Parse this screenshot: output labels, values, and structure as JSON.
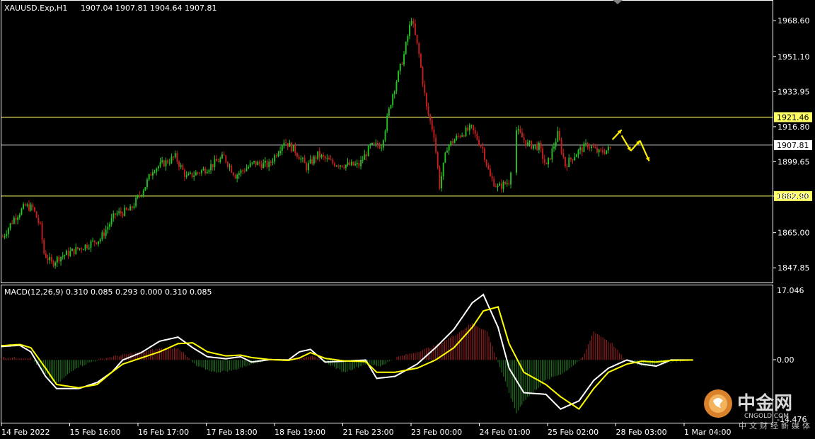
{
  "header": {
    "symbol": "XAUUSD.Exp,H1",
    "ohlc": "1907.04 1907.81 1904.64 1907.81"
  },
  "macd": {
    "label": "MACD(12,26,9) 0.310 0.085 0.293 0.000 0.310 0.085",
    "ticks": [
      "17.046",
      "0.00",
      "-14.476"
    ]
  },
  "watermark": {
    "cn": "中金网",
    "en": "CNGOLD.COM",
    "sub": "中文财经新媒体"
  },
  "colors": {
    "bull": "#22c322",
    "bear": "#c81e1e",
    "level": "#ffff66",
    "current": "#bfbfbf",
    "macd_line": "#ffffff",
    "signal_line": "#ffff00",
    "arrow": "#ffee00"
  },
  "chart_data": [
    {
      "type": "candlestick",
      "title": "XAUUSD.Exp,H1",
      "y_ticks": [
        "1968.60",
        "1951.10",
        "1933.95",
        "1916.80",
        "1899.65",
        "1882.90",
        "1865.00",
        "1847.85"
      ],
      "ylim": [
        1841,
        1978
      ],
      "x_labels": [
        "14 Feb 2022",
        "15 Feb 16:00",
        "16 Feb 17:00",
        "17 Feb 18:00",
        "18 Feb 19:00",
        "21 Feb 23:00",
        "23 Feb 00:00",
        "24 Feb 01:00",
        "25 Feb 02:00",
        "28 Feb 03:00",
        "1 Mar 04:00"
      ],
      "levels": [
        {
          "label": "1921.46",
          "value": 1921.46
        },
        {
          "label": "1907.81",
          "value": 1907.81
        },
        {
          "label": "1882.90",
          "value": 1882.9
        }
      ],
      "close_anchors": [
        [
          0,
          1863
        ],
        [
          6,
          1872
        ],
        [
          12,
          1878
        ],
        [
          16,
          1877
        ],
        [
          20,
          1868
        ],
        [
          22,
          1855
        ],
        [
          26,
          1850
        ],
        [
          30,
          1853
        ],
        [
          40,
          1857
        ],
        [
          52,
          1862
        ],
        [
          60,
          1874
        ],
        [
          68,
          1876
        ],
        [
          76,
          1888
        ],
        [
          80,
          1896
        ],
        [
          92,
          1902
        ],
        [
          98,
          1892
        ],
        [
          108,
          1896
        ],
        [
          118,
          1902
        ],
        [
          124,
          1893
        ],
        [
          134,
          1899
        ],
        [
          142,
          1898
        ],
        [
          150,
          1910
        ],
        [
          156,
          1905
        ],
        [
          162,
          1897
        ],
        [
          168,
          1903
        ],
        [
          176,
          1899
        ],
        [
          184,
          1898
        ],
        [
          190,
          1898
        ],
        [
          196,
          1907
        ],
        [
          202,
          1908
        ],
        [
          208,
          1933
        ],
        [
          214,
          1952
        ],
        [
          218,
          1970
        ],
        [
          222,
          1952
        ],
        [
          226,
          1926
        ],
        [
          230,
          1913
        ],
        [
          233,
          1888
        ],
        [
          237,
          1907
        ],
        [
          244,
          1913
        ],
        [
          250,
          1916
        ],
        [
          256,
          1906
        ],
        [
          260,
          1892
        ],
        [
          264,
          1887
        ],
        [
          270,
          1890
        ],
        [
          274,
          1915
        ],
        [
          280,
          1908
        ],
        [
          286,
          1907
        ],
        [
          290,
          1897
        ],
        [
          296,
          1913
        ],
        [
          300,
          1898
        ],
        [
          306,
          1904
        ],
        [
          312,
          1908
        ],
        [
          318,
          1904
        ],
        [
          324,
          1906
        ]
      ],
      "gap": [
        271,
        274
      ],
      "forecast_zigzag": [
        [
          1910.5
        ],
        [
          1912.5
        ],
        [
          1905
        ],
        [
          1910
        ],
        [
          1900
        ]
      ]
    },
    {
      "type": "line",
      "title": "MACD(12,26,9)",
      "ylim": [
        -14.476,
        17.046
      ],
      "series": [
        {
          "name": "MACD",
          "points": [
            [
              0,
              3.3
            ],
            [
              10,
              3.6
            ],
            [
              16,
              2.0
            ],
            [
              24,
              -4.0
            ],
            [
              30,
              -7.0
            ],
            [
              42,
              -7.0
            ],
            [
              52,
              -5.5
            ],
            [
              60,
              -3.0
            ],
            [
              66,
              0.0
            ],
            [
              76,
              1.8
            ],
            [
              86,
              4.6
            ],
            [
              96,
              5.6
            ],
            [
              104,
              3.0
            ],
            [
              112,
              0.8
            ],
            [
              122,
              0.3
            ],
            [
              130,
              0.8
            ],
            [
              136,
              -0.5
            ],
            [
              146,
              0.1
            ],
            [
              156,
              0.0
            ],
            [
              162,
              2.0
            ],
            [
              168,
              2.6
            ],
            [
              176,
              -0.5
            ],
            [
              186,
              -0.3
            ],
            [
              198,
              0.0
            ],
            [
              204,
              -4.5
            ],
            [
              214,
              -4.0
            ],
            [
              226,
              -1.0
            ],
            [
              236,
              3.0
            ],
            [
              246,
              7.5
            ],
            [
              256,
              14.0
            ],
            [
              262,
              16.0
            ],
            [
              270,
              8.0
            ],
            [
              276,
              -2.0
            ],
            [
              284,
              -8.0
            ],
            [
              296,
              -8.4
            ],
            [
              304,
              -12.0
            ],
            [
              314,
              -10.0
            ],
            [
              322,
              -5.0
            ],
            [
              330,
              -2.0
            ],
            [
              340,
              0.0
            ],
            [
              348,
              -1.0
            ],
            [
              356,
              -1.5
            ],
            [
              364,
              0.0
            ],
            [
              376,
              0.0
            ]
          ]
        },
        {
          "name": "Signal",
          "points": [
            [
              0,
              3.5
            ],
            [
              10,
              3.8
            ],
            [
              16,
              3.0
            ],
            [
              24,
              -2.0
            ],
            [
              30,
              -6.0
            ],
            [
              42,
              -6.8
            ],
            [
              52,
              -6.0
            ],
            [
              60,
              -3.0
            ],
            [
              66,
              -1.0
            ],
            [
              76,
              0.5
            ],
            [
              86,
              2.0
            ],
            [
              96,
              4.0
            ],
            [
              104,
              4.2
            ],
            [
              112,
              2.0
            ],
            [
              122,
              1.0
            ],
            [
              130,
              1.2
            ],
            [
              136,
              0.6
            ],
            [
              146,
              0.1
            ],
            [
              156,
              -0.1
            ],
            [
              162,
              0.5
            ],
            [
              168,
              1.8
            ],
            [
              176,
              0.4
            ],
            [
              186,
              -0.2
            ],
            [
              198,
              -0.4
            ],
            [
              204,
              -3.0
            ],
            [
              214,
              -3.0
            ],
            [
              226,
              -2.0
            ],
            [
              236,
              0.0
            ],
            [
              246,
              3.0
            ],
            [
              256,
              8.0
            ],
            [
              262,
              12.0
            ],
            [
              270,
              13.0
            ],
            [
              276,
              4.0
            ],
            [
              284,
              -3.0
            ],
            [
              296,
              -6.0
            ],
            [
              304,
              -9.0
            ],
            [
              314,
              -12.0
            ],
            [
              322,
              -7.0
            ],
            [
              330,
              -3.0
            ],
            [
              340,
              -1.0
            ],
            [
              348,
              -0.3
            ],
            [
              356,
              -0.5
            ],
            [
              364,
              -0.1
            ],
            [
              376,
              0.0
            ]
          ]
        }
      ],
      "histogram": [
        [
          0,
          0.6
        ],
        [
          16,
          0.5
        ],
        [
          24,
          -3.5
        ],
        [
          30,
          -6.0
        ],
        [
          40,
          -2.0
        ],
        [
          52,
          0.0
        ],
        [
          60,
          0.8
        ],
        [
          70,
          1.5
        ],
        [
          86,
          2.8
        ],
        [
          96,
          3.0
        ],
        [
          106,
          -1.5
        ],
        [
          116,
          -3.0
        ],
        [
          126,
          -2.5
        ],
        [
          136,
          -1.0
        ],
        [
          146,
          0.3
        ],
        [
          156,
          0.2
        ],
        [
          168,
          1.0
        ],
        [
          176,
          -0.5
        ],
        [
          186,
          -3.0
        ],
        [
          198,
          -1.0
        ],
        [
          206,
          -1.5
        ],
        [
          216,
          0.8
        ],
        [
          226,
          2.0
        ],
        [
          236,
          3.5
        ],
        [
          246,
          6.0
        ],
        [
          256,
          9.0
        ],
        [
          264,
          7.0
        ],
        [
          272,
          -3.0
        ],
        [
          280,
          -13.0
        ],
        [
          284,
          -10.0
        ],
        [
          296,
          -5.0
        ],
        [
          306,
          -3.0
        ],
        [
          316,
          0.5
        ],
        [
          322,
          7.0
        ],
        [
          332,
          4.0
        ],
        [
          340,
          -0.5
        ],
        [
          350,
          -1.5
        ],
        [
          364,
          -0.5
        ],
        [
          376,
          0.0
        ]
      ]
    }
  ]
}
